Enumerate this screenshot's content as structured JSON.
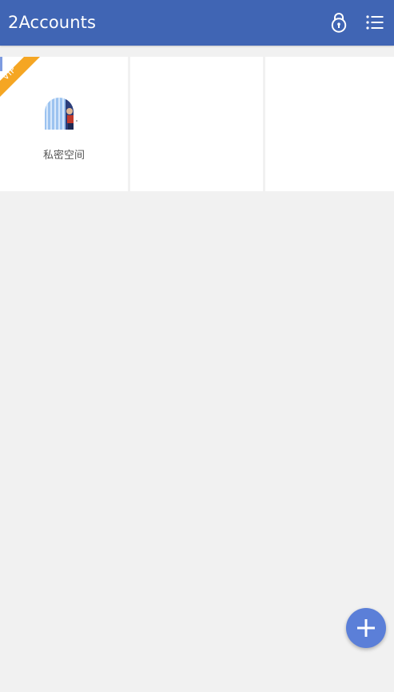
{
  "app": {
    "title": "2Accounts"
  },
  "toolbar": {
    "lock_icon": "lock-icon",
    "menu_icon": "list-menu-icon"
  },
  "accounts": [
    {
      "label": "私密空间",
      "badge": "VIP",
      "icon": "avatar-icon"
    }
  ],
  "fab": {
    "icon": "plus-icon"
  },
  "colors": {
    "appbar": "#4065b4",
    "background": "#f1f1f1",
    "card": "#ffffff",
    "vip_ribbon": "#f5a623",
    "fab": "#5b7fd8"
  }
}
